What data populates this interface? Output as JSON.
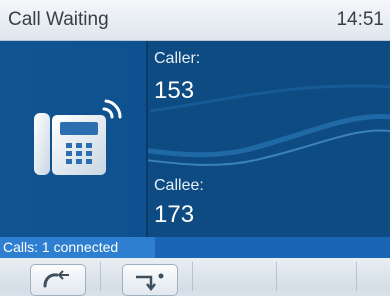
{
  "header": {
    "title": "Call Waiting",
    "time": "14:51"
  },
  "call": {
    "caller_label": "Caller:",
    "caller_number": "153",
    "callee_label": "Callee:",
    "callee_number": "173"
  },
  "status": {
    "text": "Calls: 1 connected"
  },
  "softkeys": [
    {
      "icon": "call-back-icon"
    },
    {
      "icon": "call-transfer-icon"
    }
  ],
  "colors": {
    "main_bg": "#0d4b82",
    "status_bar": "#1b66b4",
    "status_label": "#2f7fd0"
  }
}
